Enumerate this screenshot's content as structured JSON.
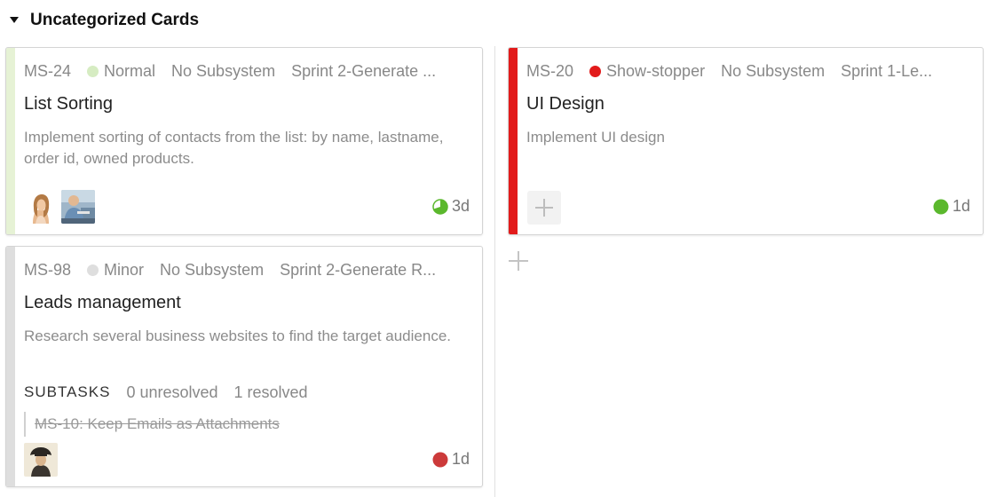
{
  "swimlane": {
    "title": "Uncategorized Cards"
  },
  "colors": {
    "normal_bar": "#e6f2d5",
    "normal_dot": "#d6ecc2",
    "showstopper": "#e21b1b",
    "minor": "#dedede",
    "estimate_green": "#5bb82d",
    "estimate_red": "#cc3a3a"
  },
  "cards": [
    {
      "id": "MS-24",
      "priority": "Normal",
      "subsystem": "No Subsystem",
      "sprint": "Sprint 2-Generate ...",
      "title": "List Sorting",
      "description": "Implement sorting of contacts from the list: by name, lastname, order id, owned products.",
      "estimate": "3d",
      "estimate_icon": "partial-pie-icon",
      "assignees": [
        "avatar-woman",
        "avatar-man"
      ]
    },
    {
      "id": "MS-20",
      "priority": "Show-stopper",
      "subsystem": "No Subsystem",
      "sprint": "Sprint 1-Le...",
      "title": "UI Design",
      "description": "Implement UI design",
      "estimate": "1d",
      "estimate_icon": "green-circle-icon",
      "assignees": []
    },
    {
      "id": "MS-98",
      "priority": "Minor",
      "subsystem": "No Subsystem",
      "sprint": "Sprint 2-Generate R...",
      "title": "Leads management",
      "description": "Research several business websites to find the target audience.",
      "subtasks": {
        "label": "SUBTASKS",
        "unresolved": "0 unresolved",
        "resolved": "1 resolved",
        "items": [
          {
            "text": "MS-10: Keep Emails as Attachments"
          }
        ]
      },
      "estimate": "1d",
      "estimate_icon": "red-circle-icon",
      "assignees": [
        "avatar-hat"
      ]
    }
  ]
}
